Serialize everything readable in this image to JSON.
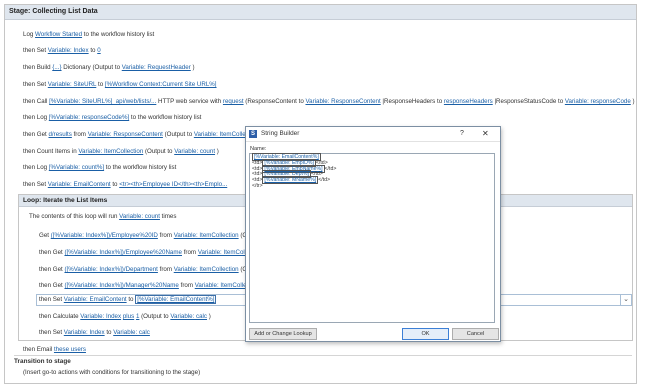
{
  "stage": {
    "title": "Stage: Collecting List Data",
    "rows": [
      {
        "p": [
          "Log "
        ],
        "l1": "Workflow Started",
        "s1": " to the workflow history list"
      },
      {
        "p": [
          "then Set "
        ],
        "l1": "Variable: Index",
        "s1": " to ",
        "l2": "0",
        "s2": ""
      },
      {
        "p": [
          "then Build "
        ],
        "l1": "{...}",
        "s1": " Dictionary (Output to ",
        "l2": "Variable: RequestHeader",
        "s2": " )"
      },
      {
        "p": [
          "then Set "
        ],
        "l1": "Variable: SiteURL",
        "s1": " to ",
        "l2": "[%Workflow Context:Current Site URL%]",
        "s2": ""
      },
      {
        "p": [
          "then Call "
        ],
        "l1": "[%Variable: SiteURL%]_api/web/lists/...",
        "s1": " HTTP web service with ",
        "l2": "request",
        "s2": " (ResponseContent to ",
        "l3": "Variable: ResponseContent",
        "s3": " |ResponseHeaders to ",
        "l4": "responseHeaders",
        "s4": " |ResponseStatusCode to ",
        "l5": "Variable: responseCode",
        "s5": " )"
      },
      {
        "p": [
          "then Log "
        ],
        "l1": "[%Variable: responseCode%]",
        "s1": " to the workflow history list"
      },
      {
        "p": [
          "then Get "
        ],
        "l1": "d/results",
        "s1": " from ",
        "l2": "Variable: ResponseContent",
        "s2": " (Output to ",
        "l3": "Variable: ItemCollection",
        "s3": " )"
      },
      {
        "p": [
          "then Count Items in "
        ],
        "l1": "Variable: ItemCollection",
        "s1": " (Output to ",
        "l2": "Variable: count",
        "s2": " )"
      },
      {
        "p": [
          "then Log "
        ],
        "l1": "[%Variable: count%]",
        "s1": " to the workflow history list"
      },
      {
        "p": [
          "then Set "
        ],
        "l1": "Variable: EmailContent",
        "s1": " to ",
        "l2": "<tr><th>Employee ID</th><th>Emplo...",
        "s2": ""
      }
    ],
    "then_email_prefix": "then Email ",
    "then_email_link": "these users"
  },
  "loop": {
    "title": "Loop: Iterate the List Items",
    "desc_prefix": "The contents of this loop will run ",
    "desc_link": "Variable: count",
    "desc_suffix": " times",
    "rows": [
      {
        "p": "Get ",
        "l1": "([%Variable: Index%])/Employee%20ID",
        "s1": " from ",
        "l2": "Variable: ItemCollection",
        "s2": " (Ou"
      },
      {
        "p": "then Get ",
        "l1": "([%Variable: Index%])/Employee%20Name",
        "s1": " from ",
        "l2": "Variable: ItemCollec",
        "s2": ""
      },
      {
        "p": "then Get ",
        "l1": "([%Variable: Index%])/Department",
        "s1": " from ",
        "l2": "Variable: ItemCollection",
        "s2": " (Ou"
      },
      {
        "p": "then Get ",
        "l1": "([%Variable: Index%])/Manager%20Name",
        "s1": " from ",
        "l2": "Variable: ItemCollec",
        "s2": ""
      }
    ],
    "set_prefix": "then Set ",
    "set_var": "Variable: EmailContent",
    "set_to": " to ",
    "set_val": "[%Variable: EmailContent%]",
    "calc_prefix": "then Calculate ",
    "calc_var": "Variable: Index",
    "calc_op": "plus",
    "calc_num": "1",
    "calc_out": " (Output to ",
    "calc_out_var": "Variable: calc",
    "calc_end": " )",
    "set2_prefix": "then Set ",
    "set2_var": "Variable: Index",
    "set2_to": " to ",
    "set2_val": "Variable: calc"
  },
  "transition": {
    "title": "Transition to stage",
    "text": "(Insert go-to actions with conditions for transitioning to the stage)"
  },
  "dialog": {
    "title": "String Builder",
    "help": "?",
    "close": "✕",
    "name_label": "Name:",
    "lines": [
      {
        "pre": "",
        "tok": "[%Variable: EmailContent%]",
        "post": ""
      },
      {
        "pre": "<td>",
        "tok": "[%Variable: EmpID%]",
        "post": "</td>"
      },
      {
        "pre": "<td>",
        "tok": "[%Variable: EmpName%]",
        "post": "</td>"
      },
      {
        "pre": "<td>",
        "tok": "[%Variable: Dept%]",
        "post": "</td>"
      },
      {
        "pre": "<td>",
        "tok": "[%Variable: MName%]",
        "post": "</td>"
      },
      {
        "pre": "</tr>",
        "tok": "",
        "post": ""
      }
    ],
    "lookup_button": "Add or Change Lookup",
    "ok_button": "OK",
    "cancel_button": "Cancel"
  }
}
